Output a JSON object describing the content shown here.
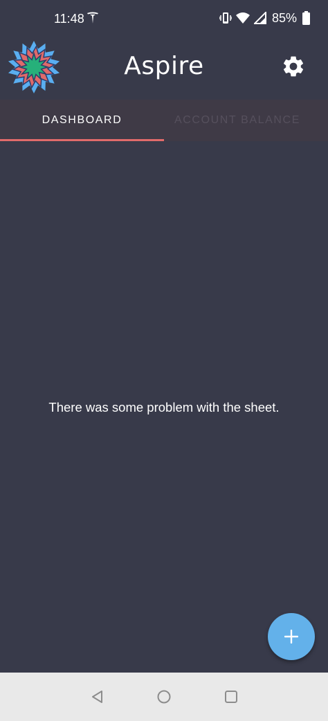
{
  "status_bar": {
    "time": "11:48",
    "battery": "85%",
    "icons": [
      "tesla-icon",
      "vibrate-icon",
      "wifi-icon",
      "signal-icon",
      "battery-icon"
    ]
  },
  "app_bar": {
    "title": "Aspire",
    "logo_icon": "starburst-logo-icon",
    "settings_icon": "gear-icon"
  },
  "tabs": [
    {
      "label": "DASHBOARD",
      "selected": true
    },
    {
      "label": "ACCOUNT BALANCE",
      "selected": false
    }
  ],
  "main": {
    "message": "There was some problem with the sheet."
  },
  "fab": {
    "icon": "plus-icon"
  },
  "nav_bar": {
    "icons": [
      "back-icon",
      "home-icon",
      "recents-icon"
    ]
  },
  "colors": {
    "background": "#383a4a",
    "tab_bar": "#3f3a46",
    "tab_indicator": "#e26b6b",
    "fab": "#63b1ea",
    "nav_bar": "#e9e9e9"
  }
}
